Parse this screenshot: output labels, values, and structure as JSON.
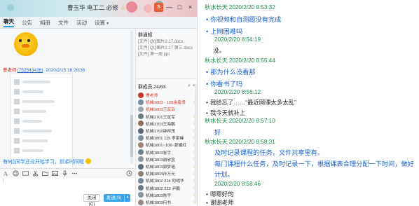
{
  "window": {
    "title": "曹玉华 电工二 必修",
    "star": "☆",
    "buttons": {
      "skin": "S",
      "min": "—",
      "max": "□",
      "close": "×"
    }
  },
  "tabs": [
    {
      "label": "聊天"
    },
    {
      "label": "公告"
    },
    {
      "label": "相册"
    },
    {
      "label": "文件"
    },
    {
      "label": "活动"
    },
    {
      "label": "设置"
    }
  ],
  "tab_caret": "▾",
  "chat": {
    "sender": "曹老师",
    "sender_id": "(752543436)",
    "time": "2020/2/15 16:29:36",
    "notice": "有9位同学还没开始学习，抓紧时间啦"
  },
  "composer": {
    "close_label": "关闭(C)",
    "send_label": "发送(S)",
    "send_caret": "▾"
  },
  "side": {
    "files_header": "群通知",
    "files": [
      {
        "kind": "[文件]",
        "name": "QQ图片2.17.docx"
      },
      {
        "kind": "[文件]",
        "name": "QQ图片2.17 第三.docx"
      },
      {
        "kind": "[文件]",
        "name": "第一周.ppt"
      }
    ],
    "members_header": "群成员 24/63",
    "tools": {
      "search": "⌕",
      "add": "+"
    },
    "members": [
      {
        "name": "曹老师",
        "red": true,
        "badge": "",
        "color": "#c0392b"
      },
      {
        "name": "机械1803 - 109金鑫博",
        "red": true,
        "badge": "☆",
        "color": "#7a8b99"
      },
      {
        "name": "机械1803王云云",
        "red": true,
        "badge": "",
        "color": "#9aa7b2"
      },
      {
        "name": "机械1701王定军",
        "red": false,
        "badge": "☆",
        "color": "#6d7d88"
      },
      {
        "name": "机械1703王海鹏",
        "red": false,
        "badge": "☆",
        "color": "#8a6d5a"
      },
      {
        "name": "机械1702钟邦茂",
        "red": false,
        "badge": "☆",
        "color": "#5c6b77"
      },
      {
        "name": "机械1801 115 李家峰",
        "red": false,
        "badge": "☆",
        "color": "#7e8f9b"
      },
      {
        "name": "机械1801~106~郭媛红",
        "red": false,
        "badge": "☆",
        "color": "#a1837a"
      },
      {
        "name": "机械1803张宇",
        "red": false,
        "badge": "☆",
        "color": "#6f8190"
      },
      {
        "name": "机械1803谢欣宜",
        "red": false,
        "badge": "☆",
        "color": "#8c98a3"
      },
      {
        "name": "机械1803郭梦瑶",
        "red": false,
        "badge": "☆",
        "color": "#5f6f7c"
      },
      {
        "name": "机械1803孙万元",
        "red": false,
        "badge": "☆",
        "color": "#93836f"
      },
      {
        "name": "机械1802 224 阿明华",
        "red": false,
        "badge": "☆",
        "color": "#77889a"
      },
      {
        "name": "机械1802 223 尹鹏",
        "red": false,
        "badge": "☆",
        "color": "#6a7884"
      },
      {
        "name": "机械1803陈宇",
        "red": false,
        "badge": "☆",
        "color": "#84939e"
      },
      {
        "name": "机械1803何书",
        "red": false,
        "badge": "☆",
        "color": "#9b8d84"
      }
    ]
  },
  "record": [
    {
      "type": "user",
      "name": "秋水长天",
      "time": "2020/2/20 8:53:32"
    },
    {
      "type": "msg",
      "dot": true,
      "text": "你视频和自测题没有完成",
      "style": "blue"
    },
    {
      "type": "msg",
      "dot": true,
      "text": "上网困难吗",
      "style": "blue"
    },
    {
      "type": "time",
      "text": "2020/2/20 8:54:19"
    },
    {
      "type": "msg",
      "dot": false,
      "text": "没。",
      "style": "plainb"
    },
    {
      "type": "user",
      "name": "秋水长天",
      "time": "2020/2/20 8:55:44"
    },
    {
      "type": "msg",
      "dot": true,
      "text": "那为什么没看那",
      "style": "blue"
    },
    {
      "type": "msg",
      "dot": true,
      "text": "你看书了吗",
      "style": "blue"
    },
    {
      "type": "time",
      "text": "2020/2/20 8:56:12"
    },
    {
      "type": "msg",
      "dot": true,
      "text": "我给忘了……“最近网课太多太乱”",
      "style": "black"
    },
    {
      "type": "msg",
      "dot": true,
      "text": "我今天就补上",
      "style": "black"
    },
    {
      "type": "user",
      "name": "秋水长天",
      "time": "2020/2/20 8:57:10"
    },
    {
      "type": "msg",
      "dot": false,
      "text": "好",
      "style": "plain"
    },
    {
      "type": "user",
      "name": "秋水长天",
      "time": "2020/2/20 8:58:31"
    },
    {
      "type": "msg",
      "dot": false,
      "text": "及时记录课程的任务，文件共享里有。",
      "style": "plain"
    },
    {
      "type": "msg",
      "dot": false,
      "text": "每门课程什么任务，及时记录一下，根据课表合理分配一下时间，做好",
      "style": "plain"
    },
    {
      "type": "msg",
      "dot": false,
      "text": "计划。",
      "style": "plain"
    },
    {
      "type": "time",
      "text": "2020/2/20 8:58:46"
    },
    {
      "type": "msg",
      "dot": true,
      "text": "嗯嗯好的",
      "style": "black"
    },
    {
      "type": "msg",
      "dot": true,
      "text": "谢谢老师",
      "style": "black"
    }
  ]
}
